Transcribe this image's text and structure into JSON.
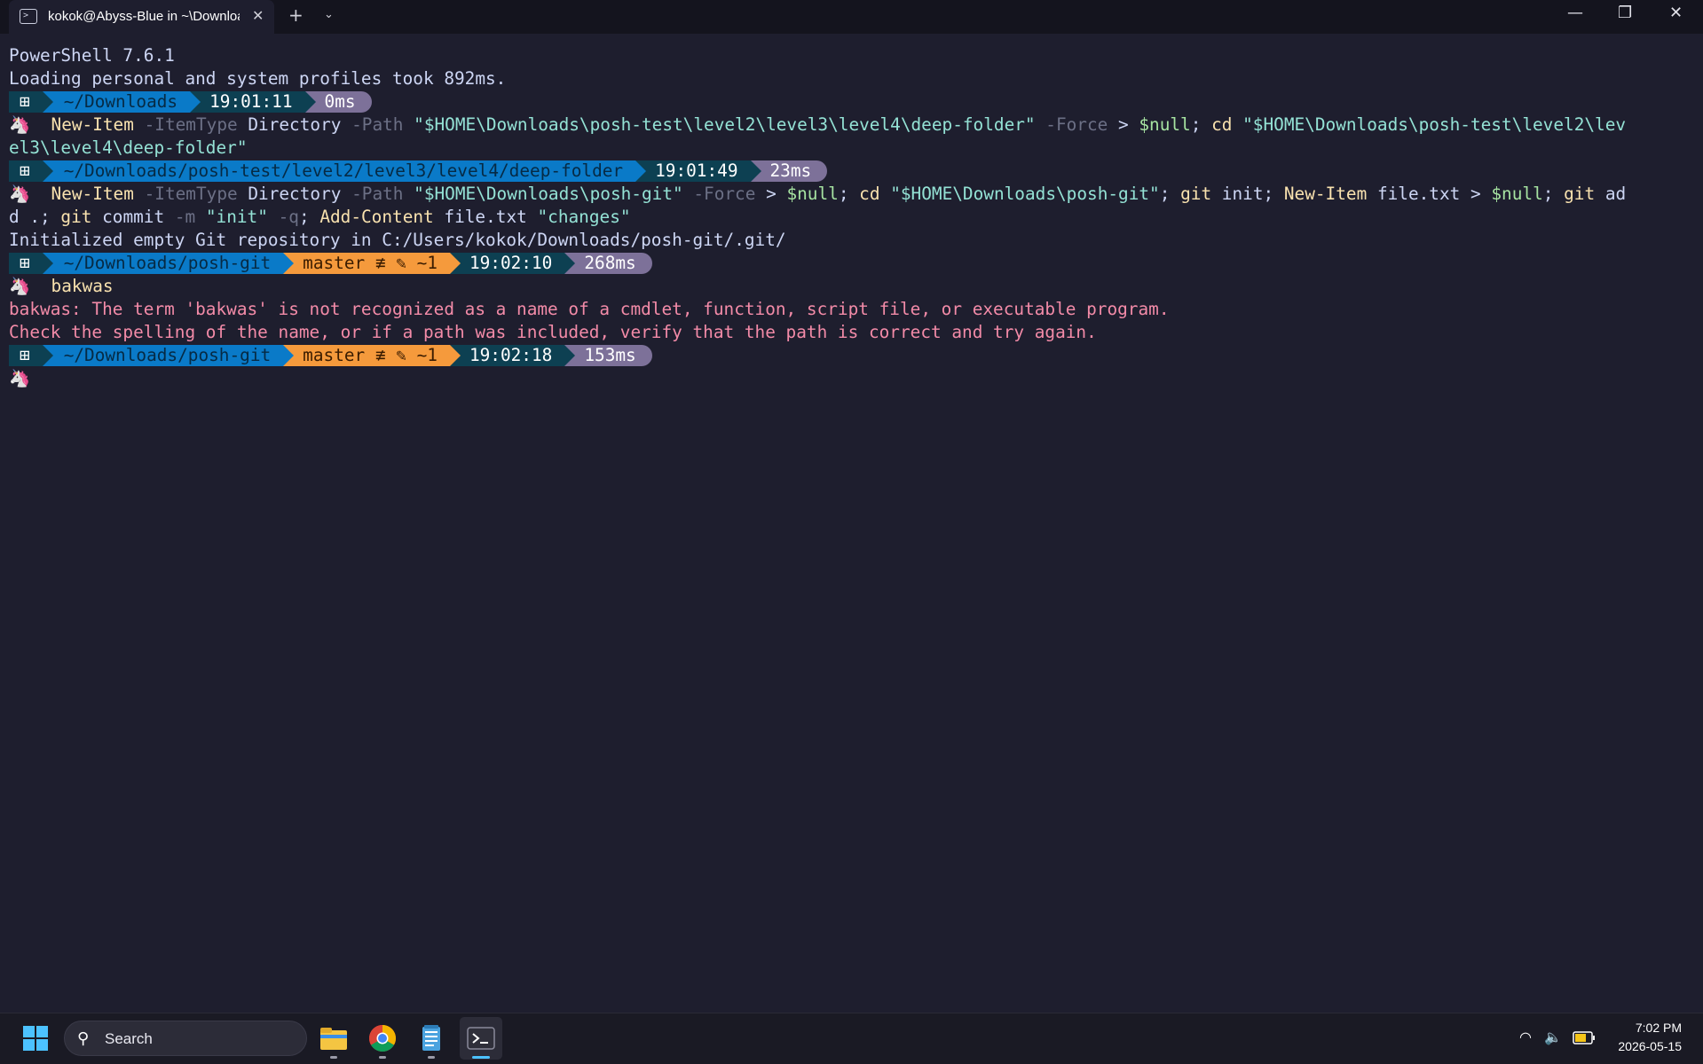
{
  "window": {
    "tab_title": "kokok@Abyss-Blue in ~\\Downloads\\posh-git",
    "tab_close": "✕",
    "new_tab": "+",
    "tab_menu": "⌄",
    "minimize": "—",
    "restore": "❐",
    "close": "✕"
  },
  "terminal": {
    "banner1": "PowerShell 7.6.1",
    "banner2": "Loading personal and system profiles took 892ms.",
    "prompt_symbol": "🦄",
    "prompts": [
      {
        "os": "⊞",
        "path": "~/Downloads",
        "time": "19:01:11",
        "exec": "0ms"
      },
      {
        "os": "⊞",
        "path": "~/Downloads/posh-test/level2/level3/level4/deep-folder",
        "time": "19:01:49",
        "exec": "23ms"
      },
      {
        "os": "⊞",
        "path": "~/Downloads/posh-git",
        "git": "master ≢ ✎ ~1",
        "time": "19:02:10",
        "exec": "268ms"
      },
      {
        "os": "⊞",
        "path": "~/Downloads/posh-git",
        "git": "master ≢ ✎ ~1",
        "time": "19:02:18",
        "exec": "153ms"
      }
    ],
    "cmd1": {
      "t1": "New-Item",
      "t2": " -ItemType",
      "t3": " Directory",
      "t4": " -Path",
      "t5": " \"$HOME\\Downloads\\posh-test\\level2\\level3\\level4\\deep-folder\"",
      "t6": " -Force",
      "t7": " > ",
      "t8": "$null",
      "t9": "; ",
      "t10": "cd",
      "t11": " \"$HOME\\Downloads\\posh-test\\level2\\lev",
      "t12": "el3\\level4\\deep-folder\""
    },
    "cmd2": {
      "t1": "New-Item",
      "t2": " -ItemType",
      "t3": " Directory",
      "t4": " -Path",
      "t5": " \"$HOME\\Downloads\\posh-git\"",
      "t6": " -Force",
      "t7": " > ",
      "t8": "$null",
      "t9": "; ",
      "t10": "cd",
      "t11": " \"$HOME\\Downloads\\posh-git\"",
      "t12": "; ",
      "t13": "git",
      "t14": " init",
      "t15": "; ",
      "t16": "New-Item",
      "t17": " file.txt",
      "t18": " > ",
      "t19": "$null",
      "t20": "; ",
      "t21": "git",
      "t22": " ad",
      "t23": "d .",
      "t24": "; ",
      "t25": "git",
      "t26": " commit",
      "t27": " -m",
      "t28": " \"init\"",
      "t29": " -q",
      "t30": "; ",
      "t31": "Add-Content",
      "t32": " file.txt",
      "t33": " \"changes\""
    },
    "out_git": "Initialized empty Git repository in C:/Users/kokok/Downloads/posh-git/.git/",
    "cmd3": "bakwas",
    "err1": "bakwas: The term 'bakwas' is not recognized as a name of a cmdlet, function, script file, or executable program.",
    "err2": "Check the spelling of the name, or if a path was included, verify that the path is correct and try again."
  },
  "taskbar": {
    "search_placeholder": "Search",
    "search_icon": "⚲",
    "apps": [
      "file-explorer",
      "chrome",
      "notepad",
      "terminal"
    ],
    "tray": {
      "wifi": "◠",
      "volume": "🔈",
      "battery": "▭"
    },
    "time": "7:02 PM",
    "date": "2026-05-15"
  },
  "colors": {
    "background": "#1e1e2e",
    "segment_os": "#0d4052",
    "segment_path": "#0a7ac8",
    "segment_git": "#f59a3c",
    "segment_exec": "#7d7199",
    "error": "#f38ba8"
  }
}
